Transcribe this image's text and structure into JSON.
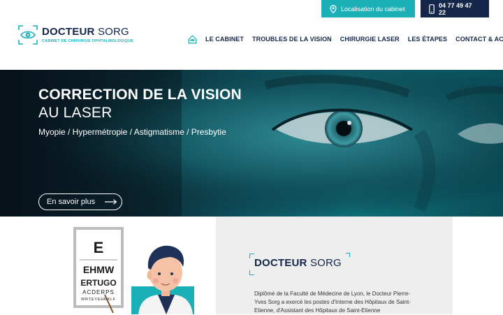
{
  "header": {
    "location_button": "Localisation du cabinet",
    "phone_button": "04 77 49 47 22",
    "logo": {
      "title_bold": "DOCTEUR",
      "title_thin": "SORG",
      "subtitle": "CABINET DE CHIRURGIE OPHTALMOLOGIQUE"
    },
    "nav": {
      "home_icon": "home-icon",
      "items": [
        "LE CABINET",
        "TROUBLES DE LA VISION",
        "CHIRURGIE LASER",
        "LES ÉTAPES",
        "CONTACT & ACCÈS"
      ]
    }
  },
  "hero": {
    "title_line1": "CORRECTION DE LA VISION",
    "title_line2": "AU LASER",
    "subtitle": "Myopie / Hypermétropie / Astigmatisme / Presbytie",
    "button_label": "En savoir plus"
  },
  "about": {
    "eye_chart": {
      "row1": "E",
      "row2": "EHMW",
      "row3": "ERTUGO",
      "row4": "ACDERPS",
      "row5": "WRTEYEHKKLF"
    },
    "title_bold": "DOCTEUR",
    "title_thin": "SORG",
    "text": "Diplômé de la Faculté de Médecine de Lyon, le Docteur Pierre-Yves Sorg a exercé les postes d'Interne des Hôpitaux de Saint-Etienne, d'Assistant des Hôpitaux de Saint-Etienne"
  },
  "colors": {
    "teal": "#1bb0b8",
    "navy": "#14264a",
    "card_bg": "#eeeeee"
  }
}
